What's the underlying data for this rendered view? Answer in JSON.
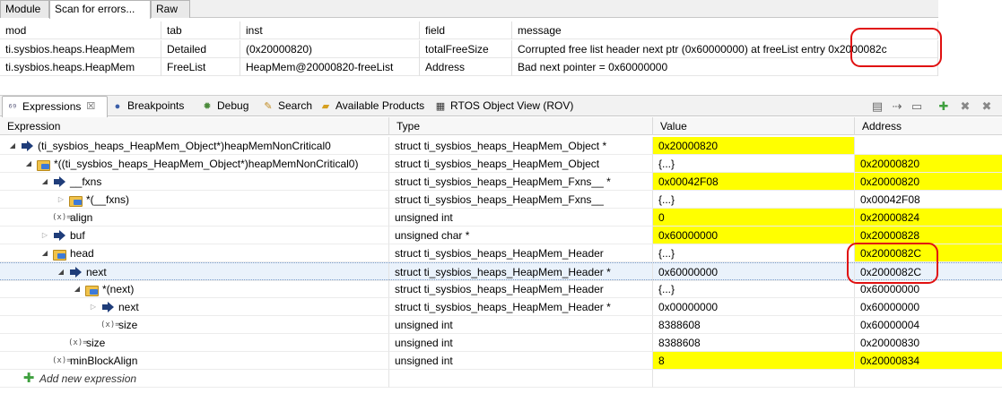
{
  "rov": {
    "tabs": [
      "Module",
      "Scan for errors...",
      "Raw"
    ],
    "headers": [
      "mod",
      "tab",
      "inst",
      "field",
      "message"
    ],
    "rows": [
      [
        "ti.sysbios.heaps.HeapMem",
        "Detailed",
        "(0x20000820)",
        "totalFreeSize",
        "Corrupted free list header next ptr (0x60000000) at freeList entry 0x2000082c"
      ],
      [
        "ti.sysbios.heaps.HeapMem",
        "FreeList",
        "HeapMem@20000820-freeList",
        "Address",
        "Bad next pointer = 0x60000000"
      ]
    ]
  },
  "views": {
    "tabs": [
      "Expressions",
      "Breakpoints",
      "Debug",
      "Search",
      "Available Products",
      "RTOS Object View (ROV)"
    ],
    "active_close": "☒"
  },
  "toolbar": [
    "collapse-all-icon",
    "link-icon",
    "minimize-icon",
    "maximize-icon",
    "add-icon",
    "remove-icon",
    "remove-all-icon"
  ],
  "expressions": {
    "columns": [
      "Expression",
      "Type",
      "Value",
      "Address"
    ],
    "rows": [
      {
        "expr": "(ti_sysbios_heaps_HeapMem_Object*)heapMemNonCritical0",
        "type": "struct ti_sysbios_heaps_HeapMem_Object *",
        "value": "0x20000820",
        "address": ""
      },
      {
        "expr": "*((ti_sysbios_heaps_HeapMem_Object*)heapMemNonCritical0)",
        "type": "struct ti_sysbios_heaps_HeapMem_Object",
        "value": "{...}",
        "address": "0x20000820"
      },
      {
        "expr": "__fxns",
        "type": "struct ti_sysbios_heaps_HeapMem_Fxns__ *",
        "value": "0x00042F08",
        "address": "0x20000820"
      },
      {
        "expr": "*(__fxns)",
        "type": "struct ti_sysbios_heaps_HeapMem_Fxns__",
        "value": "{...}",
        "address": "0x00042F08"
      },
      {
        "expr": "align",
        "type": "unsigned int",
        "value": "0",
        "address": "0x20000824"
      },
      {
        "expr": "buf",
        "type": "unsigned char *",
        "value": "0x60000000",
        "address": "0x20000828"
      },
      {
        "expr": "head",
        "type": "struct ti_sysbios_heaps_HeapMem_Header",
        "value": "{...}",
        "address": "0x2000082C"
      },
      {
        "expr": "next",
        "type": "struct ti_sysbios_heaps_HeapMem_Header *",
        "value": "0x60000000",
        "address": "0x2000082C"
      },
      {
        "expr": "*(next)",
        "type": "struct ti_sysbios_heaps_HeapMem_Header",
        "value": "{...}",
        "address": "0x60000000"
      },
      {
        "expr": "next",
        "type": "struct ti_sysbios_heaps_HeapMem_Header *",
        "value": "0x00000000",
        "address": "0x60000000"
      },
      {
        "expr": "size",
        "type": "unsigned int",
        "value": "8388608",
        "address": "0x60000004"
      },
      {
        "expr": "size",
        "type": "unsigned int",
        "value": "8388608",
        "address": "0x20000830"
      },
      {
        "expr": "minBlockAlign",
        "type": "unsigned int",
        "value": "8",
        "address": "0x20000834"
      }
    ],
    "add_label": "Add new expression"
  },
  "colors": {
    "highlight": "#ffff00",
    "annotation": "#e01010",
    "selection": "#eaf2fb"
  }
}
